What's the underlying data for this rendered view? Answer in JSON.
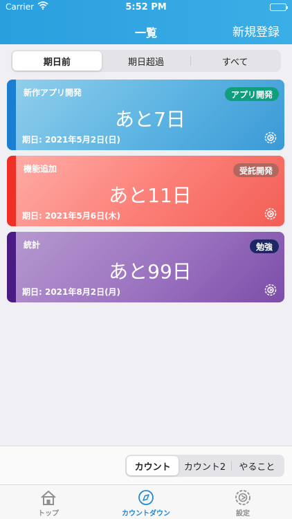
{
  "status": {
    "carrier": "Carrier",
    "time": "5:52 PM"
  },
  "nav": {
    "title": "一覧",
    "right_button": "新規登録"
  },
  "filter_tabs": [
    {
      "label": "期日前",
      "active": true
    },
    {
      "label": "期日超過",
      "active": false
    },
    {
      "label": "すべて",
      "active": false
    }
  ],
  "cards": [
    {
      "name": "新作アプリ開発",
      "tag": "アプリ開発",
      "countdown": "あと7日",
      "due": "期日: 2021年5月2日(日)"
    },
    {
      "name": "機能追加",
      "tag": "受託開発",
      "countdown": "あと11日",
      "due": "期日: 2021年5月6日(木)"
    },
    {
      "name": "統計",
      "tag": "勉強",
      "countdown": "あと99日",
      "due": "期日: 2021年8月2日(月)"
    }
  ],
  "mode_tabs": [
    {
      "label": "カウント",
      "active": true
    },
    {
      "label": "カウント2",
      "active": false
    },
    {
      "label": "やること",
      "active": false
    }
  ],
  "tabbar": [
    {
      "label": "トップ",
      "icon": "house-icon",
      "active": false
    },
    {
      "label": "カウントダウン",
      "icon": "compass-icon",
      "active": true
    },
    {
      "label": "設定",
      "icon": "gear-icon",
      "active": false
    }
  ],
  "colors": {
    "header": "#2a9fde",
    "accent": "#2388d4"
  }
}
